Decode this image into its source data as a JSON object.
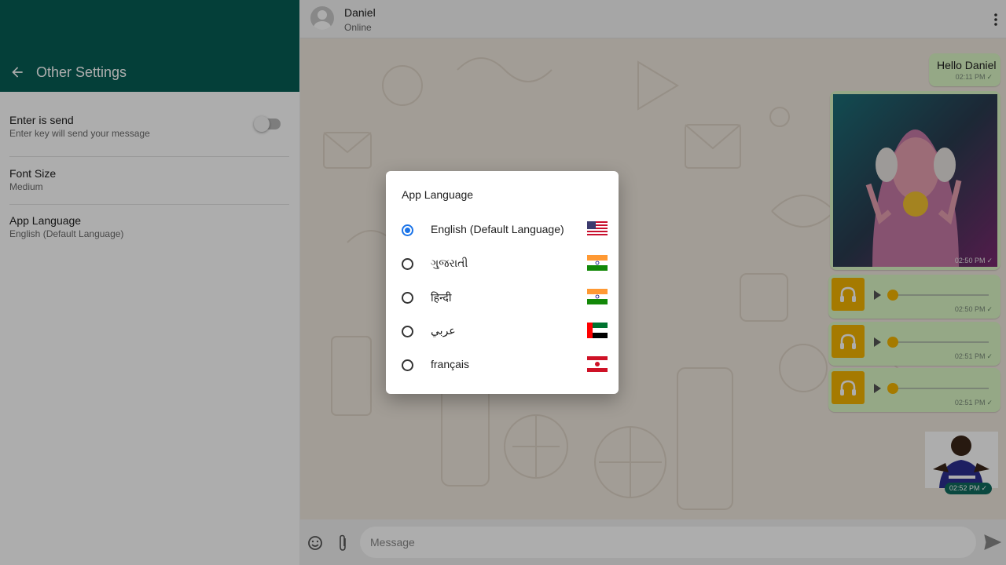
{
  "settings": {
    "title": "Other Settings",
    "items": [
      {
        "title": "Enter is send",
        "subtitle": "Enter key will send your message"
      },
      {
        "title": "Font Size",
        "subtitle": "Medium"
      },
      {
        "title": "App Language",
        "subtitle": "English (Default Language)"
      }
    ],
    "enter_is_send_enabled": false
  },
  "chat": {
    "contact_name": "Daniel",
    "contact_status": "Online",
    "messages": [
      {
        "type": "text",
        "text": "Hello Daniel",
        "time": "02:11 PM"
      },
      {
        "type": "image",
        "time": "02:50 PM"
      },
      {
        "type": "audio",
        "time": "02:50 PM"
      },
      {
        "type": "audio",
        "time": "02:51 PM"
      },
      {
        "type": "audio",
        "time": "02:51 PM"
      },
      {
        "type": "sticker",
        "time": "02:52 PM"
      }
    ],
    "input_placeholder": "Message"
  },
  "dialog": {
    "title": "App Language",
    "selected_index": 0,
    "options": [
      {
        "label": "English (Default Language)",
        "flag": "us-flag"
      },
      {
        "label": "ગુજરાતી",
        "flag": "india-flag"
      },
      {
        "label": "हिन्दी",
        "flag": "india-flag"
      },
      {
        "label": "عربي",
        "flag": "uae-flag"
      },
      {
        "label": "français",
        "flag": "french-polynesia-flag"
      }
    ]
  },
  "colors": {
    "header_green": "#075e54",
    "bubble_green": "#dcf8c6",
    "radio_blue": "#1a73e8",
    "audio_yellow": "#f4b400"
  }
}
